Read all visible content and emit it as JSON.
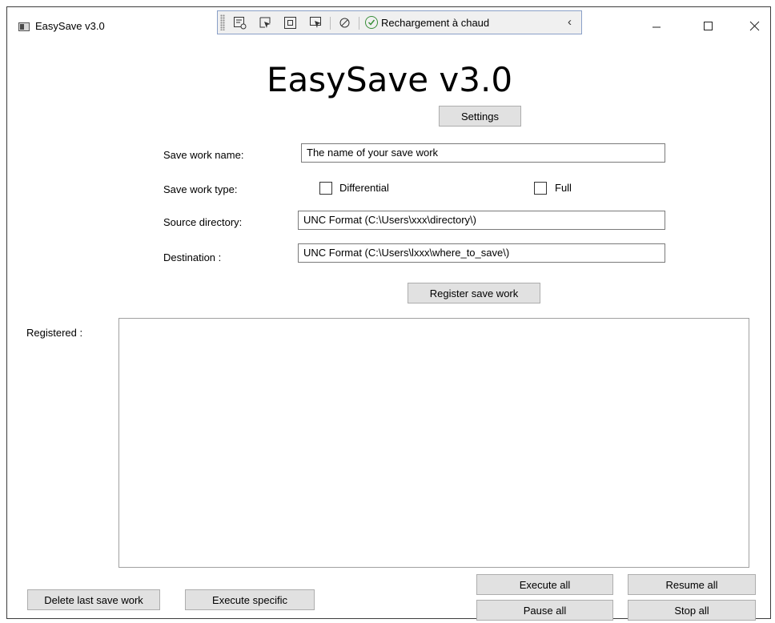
{
  "window": {
    "title": "EasySave v3.0"
  },
  "debug_toolbar": {
    "hot_reload_label": "Rechargement à chaud"
  },
  "header": {
    "title": "EasySave v3.0",
    "settings_label": "Settings"
  },
  "form": {
    "name_label": "Save work name:",
    "name_value": "The name of your save work",
    "type_label": "Save work type:",
    "differential_label": "Differential",
    "differential_checked": false,
    "full_label": "Full",
    "full_checked": false,
    "source_label": "Source directory:",
    "source_value": "UNC Format (C:\\Users\\xxx\\directory\\)",
    "destination_label": "Destination :",
    "destination_value": "UNC Format (C:\\Users\\lxxx\\where_to_save\\)",
    "register_label": "Register save work"
  },
  "registered": {
    "label": "Registered :",
    "items": []
  },
  "actions": {
    "delete_last": "Delete last save work",
    "execute_specific": "Execute specific",
    "execute_all": "Execute all",
    "resume_all": "Resume all",
    "pause_all": "Pause all",
    "stop_all": "Stop all"
  }
}
